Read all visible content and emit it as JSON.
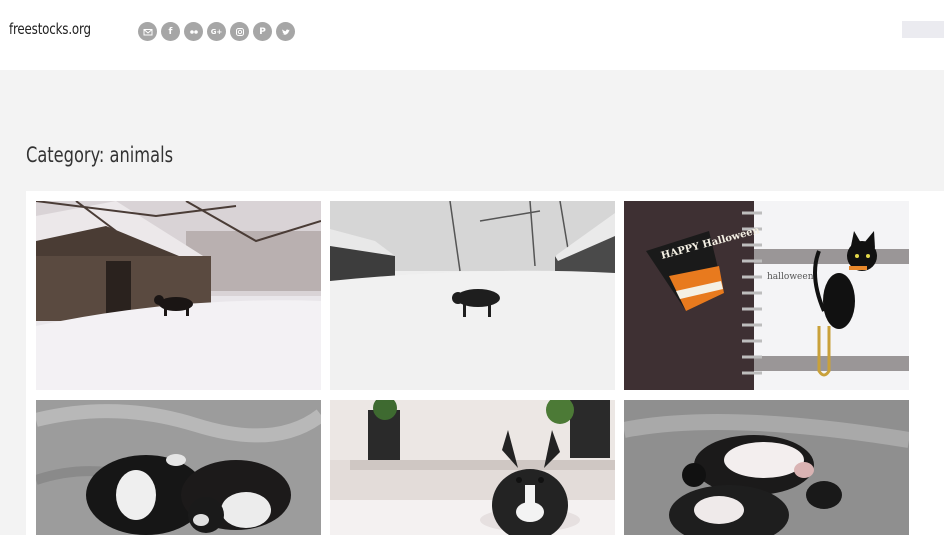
{
  "site": {
    "logo": "freestocks.org"
  },
  "social_icons": [
    {
      "name": "email-icon",
      "glyph": "✉"
    },
    {
      "name": "facebook-icon",
      "glyph": "f"
    },
    {
      "name": "flickr-icon",
      "glyph": "••"
    },
    {
      "name": "google-plus-icon",
      "glyph": "G+"
    },
    {
      "name": "instagram-icon",
      "glyph": "◎"
    },
    {
      "name": "pinterest-icon",
      "glyph": "P"
    },
    {
      "name": "twitter-icon",
      "glyph": "t"
    }
  ],
  "page": {
    "title": "Category: animals"
  },
  "photos": [
    {
      "subject": "black dog in snow by old wooden barn"
    },
    {
      "subject": "black dog walking through snowy field"
    },
    {
      "subject": "halloween notebook with black cat paper clip",
      "tag_text": "HAPPY Halloween",
      "note_text": "halloween"
    },
    {
      "subject": "two sleeping puppies on grey blanket"
    },
    {
      "subject": "boston terrier dog on bed"
    },
    {
      "subject": "puppies sleeping curled up"
    }
  ],
  "colors": {
    "background": "#f3f3f3",
    "header": "#ffffff",
    "social": "#a6a6a6"
  }
}
